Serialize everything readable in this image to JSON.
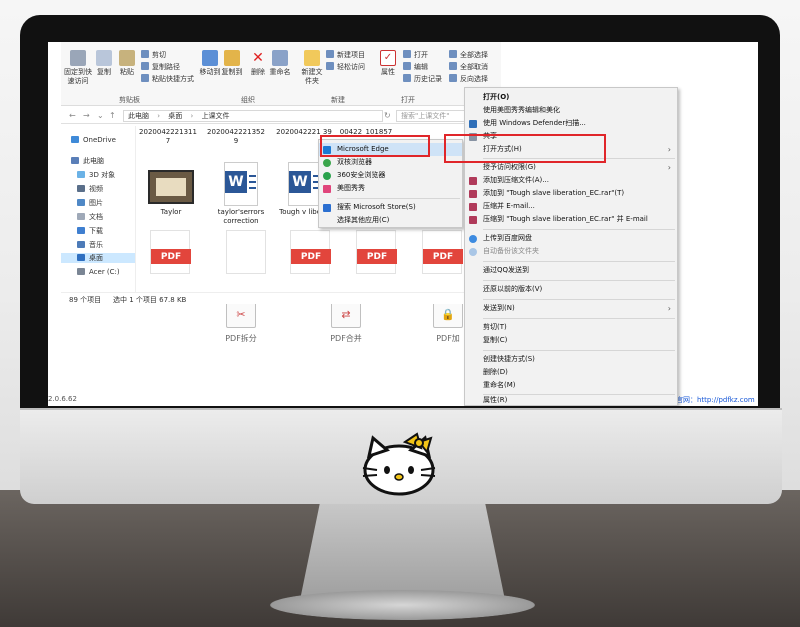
{
  "desktop": {
    "icons": [
      {
        "label": "PDF拆分"
      },
      {
        "label": "PDF合并"
      },
      {
        "label": "PDF加"
      }
    ],
    "version_text": "2.0.6.62",
    "site_text": "官网：http://pdfkz.com"
  },
  "ribbon": {
    "clipboard": {
      "pin_label": "固定到快速访问",
      "copy_label": "复制",
      "paste_label": "粘贴",
      "cut": "剪切",
      "copy_path": "复制路径",
      "paste_shortcut": "粘贴快捷方式",
      "group": "剪贴板"
    },
    "organize": {
      "move_to": "移动到",
      "copy_to": "复制到",
      "delete": "删除",
      "rename": "重命名",
      "group": "组织"
    },
    "new": {
      "new_folder": "新建文件夹",
      "new_item": "新建项目",
      "easy_access": "轻松访问",
      "group": "新建"
    },
    "open": {
      "properties": "属性",
      "open": "打开",
      "edit": "编辑",
      "history": "历史记录",
      "group": "打开"
    },
    "select": {
      "select_all": "全部选择",
      "select_none": "全部取消",
      "invert": "反向选择"
    }
  },
  "address": {
    "path": [
      "此电脑",
      "桌面",
      "上课文件"
    ],
    "search_placeholder": "搜索\"上课文件\""
  },
  "nav_pane": {
    "items": [
      {
        "label": "OneDrive"
      },
      {
        "label": "此电脑"
      },
      {
        "label": "3D 对象"
      },
      {
        "label": "视频"
      },
      {
        "label": "图片"
      },
      {
        "label": "文档"
      },
      {
        "label": "下载"
      },
      {
        "label": "音乐"
      },
      {
        "label": "桌面"
      },
      {
        "label": "Acer (C:)"
      }
    ]
  },
  "files": {
    "row1_names": [
      "2020042221311 7",
      "2020042221352 9",
      "2020042221 39",
      "00422_101857"
    ],
    "row2_names": [
      "Taylor",
      "taylor'serrors correction",
      "Tough v liberati"
    ],
    "pdf_label": "PDF"
  },
  "status": {
    "count": "89 个项目",
    "selected": "选中 1 个项目 67.8 KB"
  },
  "open_with_submenu": {
    "items": [
      {
        "label": "Microsoft Edge"
      },
      {
        "label": "双核浏览器"
      },
      {
        "label": "360安全浏览器"
      },
      {
        "label": "美图秀秀"
      },
      {
        "label": "搜索 Microsoft Store(S)"
      },
      {
        "label": "选择其他应用(C)"
      }
    ]
  },
  "context_menu": {
    "items": [
      {
        "label": "打开(O)"
      },
      {
        "label": "使用美图秀秀编辑和美化"
      },
      {
        "label": "使用 Windows Defender扫描..."
      },
      {
        "label": "共享"
      },
      {
        "label": "打开方式(H)"
      },
      {
        "label": "授予访问权限(G)"
      },
      {
        "label": "添加到压缩文件(A)..."
      },
      {
        "label": "添加到 \"Tough slave liberation_EC.rar\"(T)"
      },
      {
        "label": "压缩并 E-mail..."
      },
      {
        "label": "压缩到 \"Tough slave liberation_EC.rar\" 并 E-mail"
      },
      {
        "label": "上传到百度网盘"
      },
      {
        "label": "自动备份该文件夹"
      },
      {
        "label": "通过QQ发送到"
      },
      {
        "label": "还原以前的版本(V)"
      },
      {
        "label": "发送到(N)"
      },
      {
        "label": "剪切(T)"
      },
      {
        "label": "复制(C)"
      },
      {
        "label": "创建快捷方式(S)"
      },
      {
        "label": "删除(D)"
      },
      {
        "label": "重命名(M)"
      },
      {
        "label": "属性(R)"
      }
    ]
  },
  "colors": {
    "highlight_box": "#e0262a",
    "selection": "#cce8ff",
    "pdf_red": "#e2453c",
    "word_blue": "#2b5797"
  }
}
